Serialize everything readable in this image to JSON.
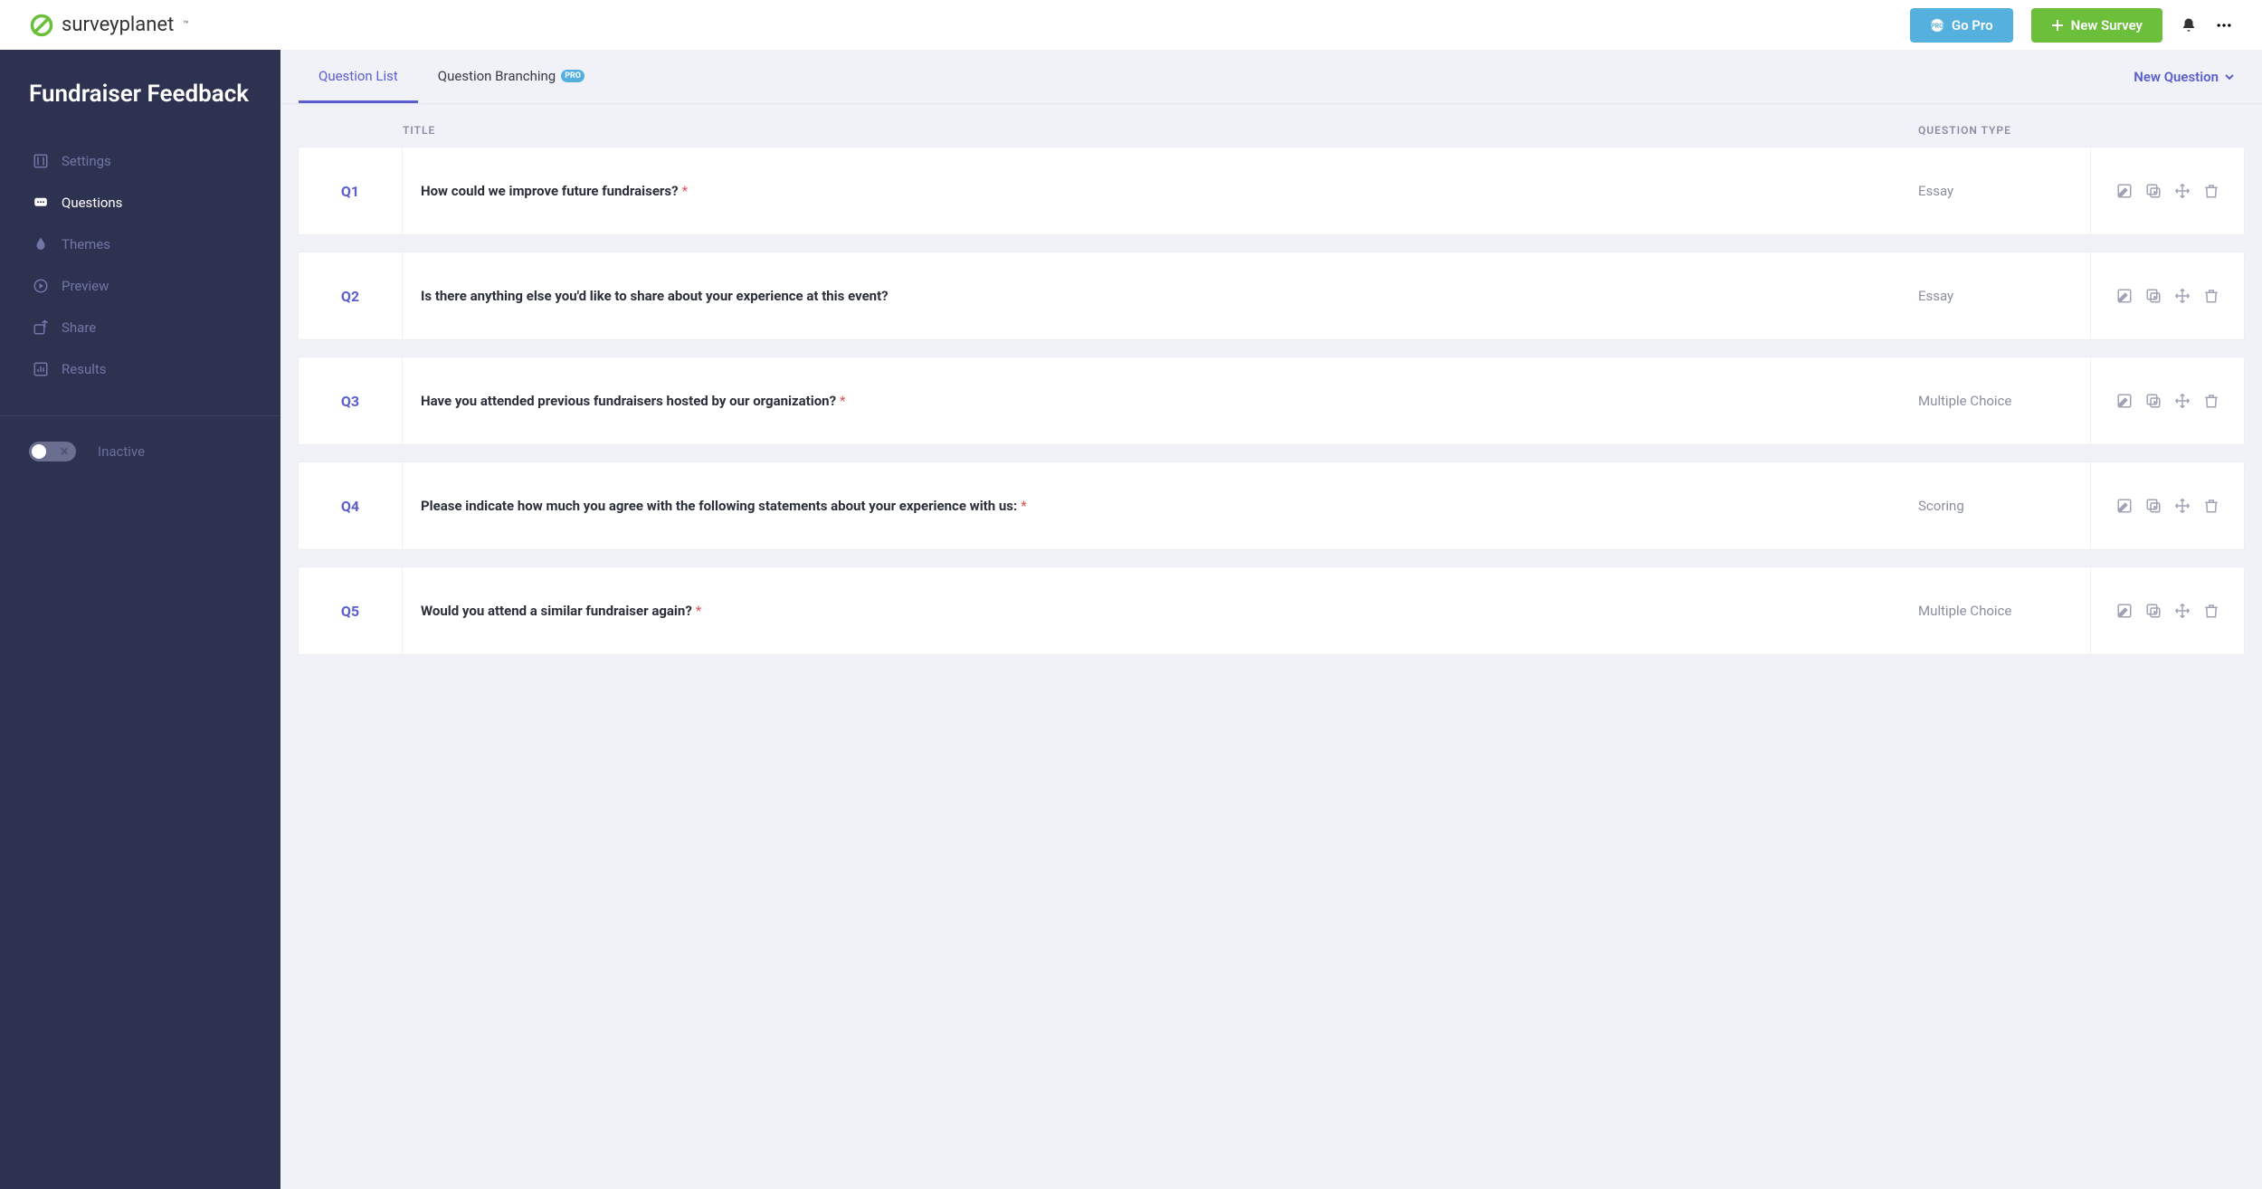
{
  "brand": {
    "name": "surveyplanet"
  },
  "header": {
    "go_pro": "Go Pro",
    "new_survey": "New Survey"
  },
  "survey": {
    "title": "Fundraiser Feedback"
  },
  "sidebar": {
    "items": [
      {
        "label": "Settings"
      },
      {
        "label": "Questions"
      },
      {
        "label": "Themes"
      },
      {
        "label": "Preview"
      },
      {
        "label": "Share"
      },
      {
        "label": "Results"
      }
    ],
    "inactive": "Inactive"
  },
  "tabs": {
    "question_list": "Question List",
    "question_branching": "Question Branching",
    "pro_badge": "PRO",
    "new_question": "New Question"
  },
  "columns": {
    "title": "TITLE",
    "type": "QUESTION TYPE"
  },
  "questions": [
    {
      "num": "Q1",
      "title": "How could we improve future fundraisers?",
      "required": true,
      "type": "Essay"
    },
    {
      "num": "Q2",
      "title": "Is there anything else you'd like to share about your experience at this event?",
      "required": false,
      "type": "Essay"
    },
    {
      "num": "Q3",
      "title": "Have you attended previous fundraisers hosted by our organization?",
      "required": true,
      "type": "Multiple Choice"
    },
    {
      "num": "Q4",
      "title": "Please indicate how much you agree with the following statements about your experience with us:",
      "required": true,
      "type": "Scoring"
    },
    {
      "num": "Q5",
      "title": "Would you attend a similar fundraiser again?",
      "required": true,
      "type": "Multiple Choice"
    }
  ]
}
